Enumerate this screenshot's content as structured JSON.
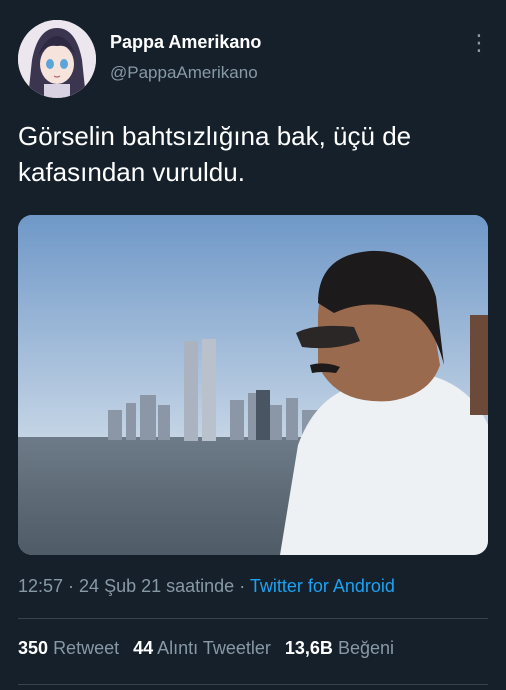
{
  "tweet": {
    "display_name": "Pappa Amerikano",
    "handle": "@PappaAmerikano",
    "more_icon": "more-vertical-icon",
    "text_line1": "Görselin bahtsızlığına bak, üçü de",
    "text_line2": "kafasından vuruldu.",
    "time": "12:57",
    "sep1": " · ",
    "date": "24 Şub 21 saatinde",
    "sep2": " · ",
    "source": "Twitter for Android"
  },
  "stats": {
    "retweet_count": "350",
    "retweet_label": "Retweet",
    "quote_count": "44",
    "quote_label": "Alıntı Tweetler",
    "like_count": "13,6B",
    "like_label": "Beğeni"
  },
  "colors": {
    "background": "#15202b",
    "secondary_text": "#8899a6",
    "link": "#1da1f2",
    "divider": "#38444d"
  }
}
